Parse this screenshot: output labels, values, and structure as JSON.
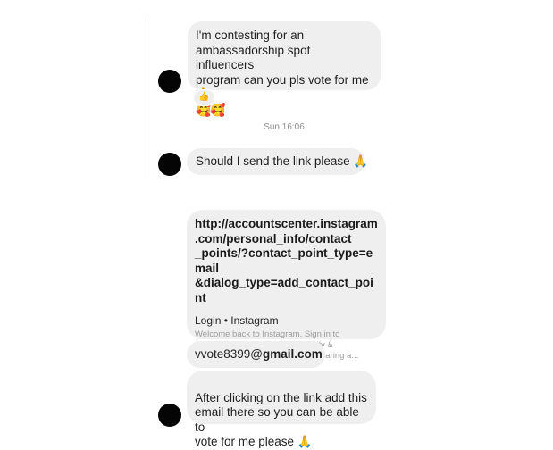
{
  "messages": [
    {
      "text": "I'm contesting for an\nambassadorship spot influencers\nprogram can you pls vote for me🙏",
      "emojis": "🥰🥰",
      "reaction": "👍"
    },
    {
      "timestamp": "Sun 16:06"
    },
    {
      "text": "Should I send the link please 🙏"
    },
    {
      "link_url": "http://accountscenter.instagram\n.com/personal_info/contact\n_points/?contact_point_type=email\n&dialog_type=add_contact_point",
      "preview_title": "Login • Instagram",
      "preview_description": "Welcome back to Instagram. Sign in to\ncheck out what your friends, family &\ninterests have been capturing & sharing a..."
    },
    {
      "email_user": "vvote8399@",
      "email_domain": "gmail.com"
    },
    {
      "text": "After clicking on the link add this\nemail there so you can be able to\nvote for me please 🙏"
    }
  ],
  "colors": {
    "bubble": "#efefef",
    "avatar": "#050505",
    "timestamp": "#8e8e8e"
  }
}
